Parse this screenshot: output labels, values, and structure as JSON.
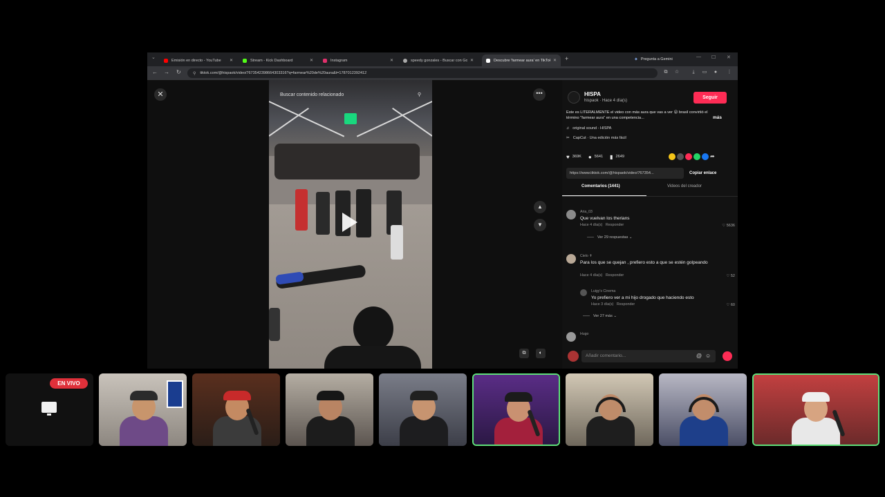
{
  "browser": {
    "tabs": [
      {
        "title": "Emisión en directo - YouTube",
        "color": "#ff0000"
      },
      {
        "title": "Stream - Kick Dashboard",
        "color": "#53fc18"
      },
      {
        "title": "Instagram",
        "color": "#e1306c"
      },
      {
        "title": "speedy gonzales - Buscar con Google",
        "color": "#aaaaaa"
      },
      {
        "title": "Descubre 'farmear aura' en TikTok",
        "color": "#ffffff"
      }
    ],
    "new_tab": "+",
    "gemini_label": "Pregunta a Gemini",
    "url": "tiktok.com/@hispaok/video/7673542398664303316?q=farmear%20de%20aura&t=1787012392412"
  },
  "video": {
    "search_placeholder": "Buscar contenido relacionado"
  },
  "post": {
    "author": "HISPA",
    "author_meta": "hispaok · Hace 4 día(s)",
    "follow_label": "Seguir",
    "description": "Este es LITERALMENTE el video con más aura que vas a ver 😮 brasil convirtió el término \"farmear aura\" en una competencia...",
    "more_label": "más",
    "sound": "original sound - HISPA",
    "capcut": "CapCut · Una edición más fácil",
    "likes": "369K",
    "comments_count": "5641",
    "saves": "2649",
    "link": "https://www.tiktok.com/@hispaok/video/767354...",
    "copy_label": "Copiar enlace",
    "tab_comments": "Comentarios (1441)",
    "tab_creator": "Videos del creador",
    "share_colors": [
      "#f5c518",
      "#555555",
      "#fe2c55",
      "#25d366",
      "#1877f2"
    ]
  },
  "comments": [
    {
      "user": "Aria_03",
      "text": "Que vuelvan los therians",
      "time": "Hace 4 día(s)",
      "reply": "Responder",
      "likes": "5636",
      "more": "Ver 29 respuestas ⌄"
    },
    {
      "user": "Cielo ✝",
      "text": "Para los que se quejan , prefiero esto a que se estén golpeando",
      "time": "Hace 4 día(s)",
      "reply": "Responder",
      "likes": "52"
    },
    {
      "user": "Luigy's Cinema",
      "text": "Yo prefiero ver a mi hijo drogado que haciendo esto",
      "time": "Hace 3 día(s)",
      "reply": "Responder",
      "likes": "60",
      "more": "Ver 27 más ⌄"
    },
    {
      "user": "Hugo",
      "text": ""
    }
  ],
  "comment_bar": {
    "placeholder": "Añadir comentario..."
  },
  "stream": {
    "live_label": "EN VIVO",
    "participants": 8
  }
}
